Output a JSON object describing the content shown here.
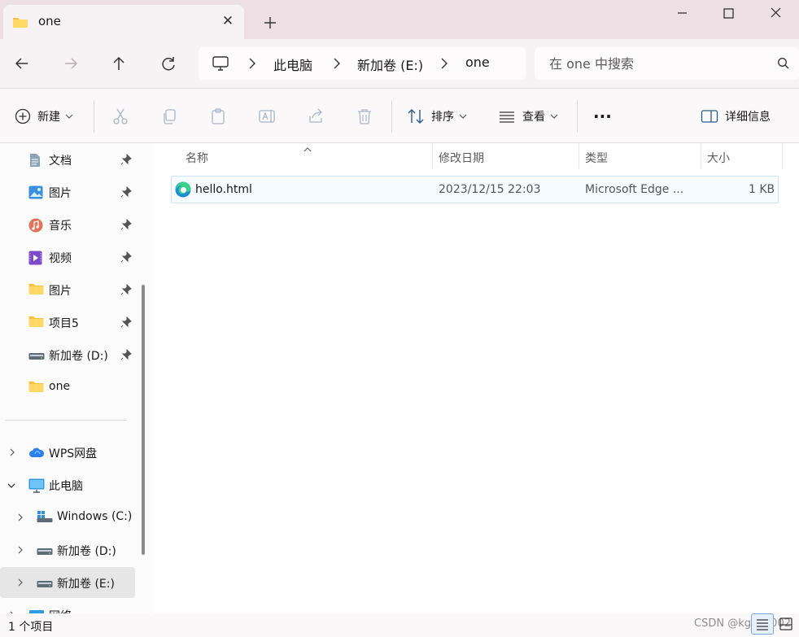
{
  "window": {
    "tab_title": "one",
    "tab_close_label": "✕",
    "new_tab_label": "+"
  },
  "breadcrumb": {
    "items": [
      "此电脑",
      "新加卷 (E:)",
      "one"
    ]
  },
  "search": {
    "placeholder": "在 one 中搜索"
  },
  "toolbar": {
    "new_label": "新建",
    "sort_label": "排序",
    "view_label": "查看",
    "more_label": "···",
    "details_label": "详细信息"
  },
  "nav": {
    "quick_access": [
      {
        "label": "文档",
        "icon": "document-icon",
        "pinned": true
      },
      {
        "label": "图片",
        "icon": "pictures-icon",
        "pinned": true
      },
      {
        "label": "音乐",
        "icon": "music-icon",
        "pinned": true
      },
      {
        "label": "视频",
        "icon": "video-icon",
        "pinned": true
      },
      {
        "label": "图片",
        "icon": "folder-icon",
        "pinned": true
      },
      {
        "label": "项目5",
        "icon": "folder-icon",
        "pinned": true
      },
      {
        "label": "新加卷 (D:)",
        "icon": "drive-icon",
        "pinned": true
      },
      {
        "label": "one",
        "icon": "folder-icon",
        "pinned": false
      }
    ],
    "tree": [
      {
        "label": "WPS网盘",
        "icon": "cloud-icon",
        "expanded": false
      },
      {
        "label": "此电脑",
        "icon": "computer-icon",
        "expanded": true
      },
      {
        "label": "Windows (C:)",
        "icon": "windows-drive-icon",
        "expanded": false
      },
      {
        "label": "新加卷 (D:)",
        "icon": "drive-icon",
        "expanded": false
      },
      {
        "label": "新加卷 (E:)",
        "icon": "drive-icon",
        "expanded": false,
        "selected": true
      },
      {
        "label": "网络",
        "icon": "network-icon",
        "expanded": false
      }
    ]
  },
  "file_list": {
    "columns": [
      "名称",
      "修改日期",
      "类型",
      "大小"
    ],
    "rows": [
      {
        "name": "hello.html",
        "modified": "2023/12/15 22:03",
        "type": "Microsoft Edge ...",
        "size": "1 KB",
        "icon": "edge-icon"
      }
    ]
  },
  "status": {
    "item_count": "1 个项目",
    "watermark": "CSDN @kgyn0002"
  },
  "colors": {
    "titlebar": "#eddfe4",
    "selection_border": "#cfe4f7",
    "selection_fill": "#f5fbff",
    "folder": "#f6c244"
  }
}
